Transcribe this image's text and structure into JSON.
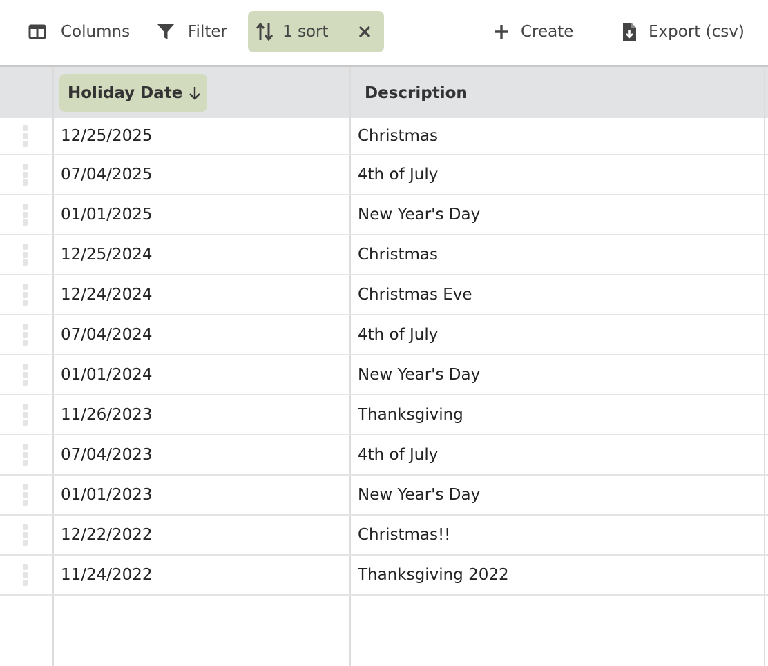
{
  "toolbar": {
    "columns_label": "Columns",
    "filter_label": "Filter",
    "sort_label": "1 sort",
    "create_label": "Create",
    "export_label": "Export (csv)"
  },
  "table": {
    "headers": {
      "date": "Holiday Date",
      "description": "Description"
    },
    "sort": {
      "column": "date",
      "direction": "descending"
    },
    "rows": [
      {
        "date": "12/25/2025",
        "description": "Christmas"
      },
      {
        "date": "07/04/2025",
        "description": "4th of July"
      },
      {
        "date": "01/01/2025",
        "description": "New Year's Day"
      },
      {
        "date": "12/25/2024",
        "description": "Christmas"
      },
      {
        "date": "12/24/2024",
        "description": "Christmas Eve"
      },
      {
        "date": "07/04/2024",
        "description": "4th of July"
      },
      {
        "date": "01/01/2024",
        "description": "New Year's Day"
      },
      {
        "date": "11/26/2023",
        "description": "Thanksgiving"
      },
      {
        "date": "07/04/2023",
        "description": "4th of July"
      },
      {
        "date": "01/01/2023",
        "description": "New Year's Day"
      },
      {
        "date": "12/22/2022",
        "description": "Christmas!!"
      },
      {
        "date": "11/24/2022",
        "description": "Thanksgiving 2022"
      }
    ]
  },
  "colors": {
    "accent": "#d3dbbf",
    "header_bg": "#e2e3e5",
    "icon": "#444444"
  },
  "icons": [
    "columns-icon",
    "filter-icon",
    "sort-icon",
    "close-icon",
    "plus-icon",
    "export-file-icon",
    "arrow-down-icon",
    "drag-handle-icon"
  ]
}
